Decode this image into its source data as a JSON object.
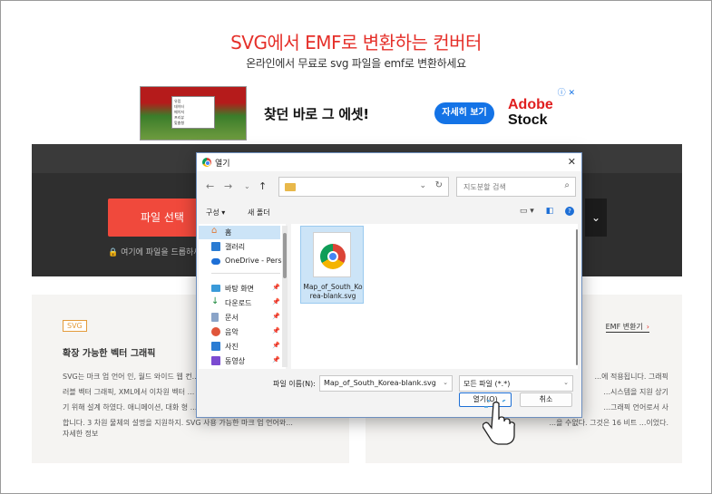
{
  "page": {
    "title": "SVG에서 EMF로 변환하는 컨버터",
    "subtitle": "온라인에서 무료로 svg 파일을 emf로 변환하세요"
  },
  "ad": {
    "headline": "찾던 바로 그 에셋!",
    "button": "자세히 보기",
    "brand_line1": "Adobe",
    "brand_line2": "Stock",
    "info_icons": "ⓘ ✕",
    "preview_lines": [
      "유럽",
      "데이터",
      "메이저",
      "프리뷰",
      "맞춤형"
    ]
  },
  "converter": {
    "file_button": "파일 선택",
    "drop_hint": "🔒 여기에 파일을 드롭하세",
    "expand": "⌄"
  },
  "cards": {
    "left": {
      "tag": "SVG",
      "title": "확장 가능한 벡터 그래픽",
      "body_lines": [
        "SVG는 마크 업 언어 인, 월드 와이드 웹 컨...",
        "러블 벡터 그래픽, XML에서 이차원 벡터 ...",
        "기 위해 설계 하였다. 애니메이션, 대화 형 ...",
        "합니다. 3 차원 물체의 설명을 지원하지. SVG 사용 가능한 마크 업 언어와..."
      ],
      "more": "자세한 정보"
    },
    "right": {
      "link": "EMF 변환기",
      "body_lines": [
        "...에 적용됩니다. 그래픽",
        "...시스템을 지원 상기",
        "...그래픽 언어로서 사",
        "...을 수없다. 그것은 16 비트 ...이었다."
      ]
    }
  },
  "dialog": {
    "title": "열기",
    "close": "✕",
    "search_placeholder": "지도분할 검색",
    "organize": "구성 ▾",
    "new_folder": "새 폴더",
    "nav_items": [
      {
        "label": "홈",
        "pinned": false
      },
      {
        "label": "갤러리",
        "pinned": false
      },
      {
        "label": "OneDrive - Perso",
        "pinned": false
      },
      {
        "label": "바탕 화면",
        "pinned": true
      },
      {
        "label": "다운로드",
        "pinned": true
      },
      {
        "label": "문서",
        "pinned": true
      },
      {
        "label": "음악",
        "pinned": true
      },
      {
        "label": "사진",
        "pinned": true
      },
      {
        "label": "동영상",
        "pinned": true
      }
    ],
    "file": {
      "name": "Map_of_South_Korea-blank.svg"
    },
    "filename_label": "파일 이름(N):",
    "filename_value": "Map_of_South_Korea-blank.svg",
    "filetype_value": "모든 파일 (*.*)",
    "open_button": "열기(O)",
    "cancel_button": "취소"
  },
  "colors": {
    "brand_red": "#e5302a",
    "button_red": "#f0493c",
    "ad_blue": "#1473e6",
    "selection_blue": "#cce4f7"
  }
}
